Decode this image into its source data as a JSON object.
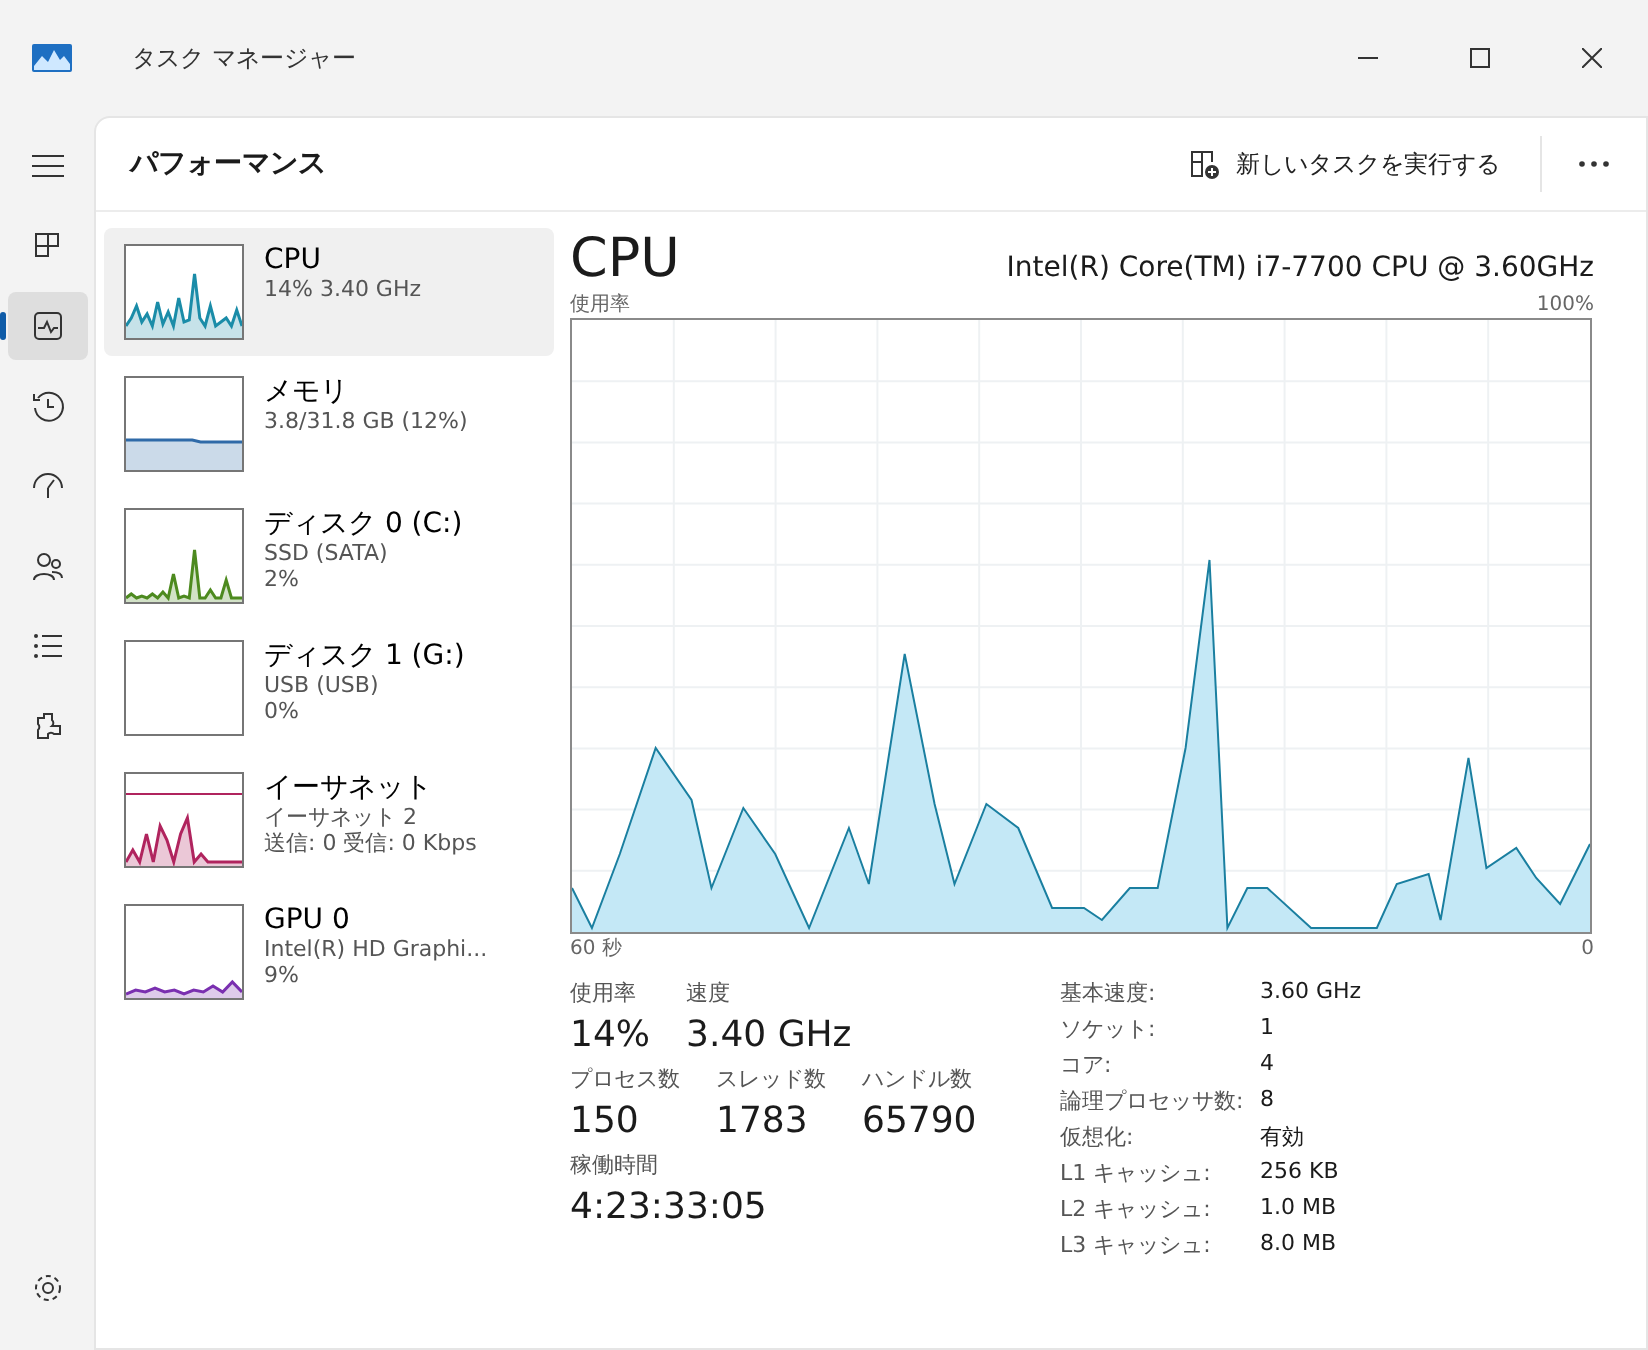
{
  "window": {
    "title": "タスク マネージャー"
  },
  "nav": [
    {
      "selected": false
    },
    {
      "selected": true
    },
    {
      "selected": false
    },
    {
      "selected": false
    },
    {
      "selected": false
    },
    {
      "selected": false
    },
    {
      "selected": false
    }
  ],
  "header": {
    "title": "パフォーマンス",
    "run_task": "新しいタスクを実行する"
  },
  "devices": [
    {
      "name": "CPU",
      "lines": [
        "14%  3.40 GHz"
      ],
      "color": "#1a8ca8",
      "kind": "cpu",
      "selected": true
    },
    {
      "name": "メモリ",
      "lines": [
        "3.8/31.8 GB (12%)"
      ],
      "color": "#2f6aa8",
      "kind": "memory",
      "selected": false
    },
    {
      "name": "ディスク 0 (C:)",
      "lines": [
        "SSD (SATA)",
        "2%"
      ],
      "color": "#4d8a1f",
      "kind": "disk",
      "selected": false
    },
    {
      "name": "ディスク 1 (G:)",
      "lines": [
        "USB (USB)",
        "0%"
      ],
      "kind": "idle",
      "selected": false
    },
    {
      "name": "イーサネット",
      "lines": [
        "イーサネット 2",
        "送信: 0 受信: 0 Kbps"
      ],
      "color": "#b0245e",
      "kind": "network",
      "selected": false
    },
    {
      "name": "GPU 0",
      "lines": [
        "Intel(R) HD Graphi...",
        "9%"
      ],
      "color": "#7a2fb0",
      "kind": "gpu",
      "selected": false
    }
  ],
  "detail": {
    "title": "CPU",
    "model": "Intel(R) Core(TM) i7-7700 CPU @ 3.60GHz",
    "graph_label": "使用率",
    "graph_max": "100%",
    "graph_start": "60 秒",
    "graph_end": "0",
    "stats_row1": [
      {
        "label": "使用率",
        "value": "14%"
      },
      {
        "label": "速度",
        "value": "3.40 GHz"
      }
    ],
    "stats_row2": [
      {
        "label": "プロセス数",
        "value": "150"
      },
      {
        "label": "スレッド数",
        "value": "1783"
      },
      {
        "label": "ハンドル数",
        "value": "65790"
      }
    ],
    "uptime": {
      "label": "稼働時間",
      "value": "4:23:33:05"
    },
    "specs": [
      {
        "label": "基本速度:",
        "value": "3.60 GHz"
      },
      {
        "label": "ソケット:",
        "value": "1"
      },
      {
        "label": "コア:",
        "value": "4"
      },
      {
        "label": "論理プロセッサ数:",
        "value": "8"
      },
      {
        "label": "仮想化:",
        "value": "有効"
      },
      {
        "label": "L1 キャッシュ:",
        "value": "256 KB"
      },
      {
        "label": "L2 キャッシュ:",
        "value": "1.0 MB"
      },
      {
        "label": "L3 キャッシュ:",
        "value": "8.0 MB"
      }
    ]
  }
}
